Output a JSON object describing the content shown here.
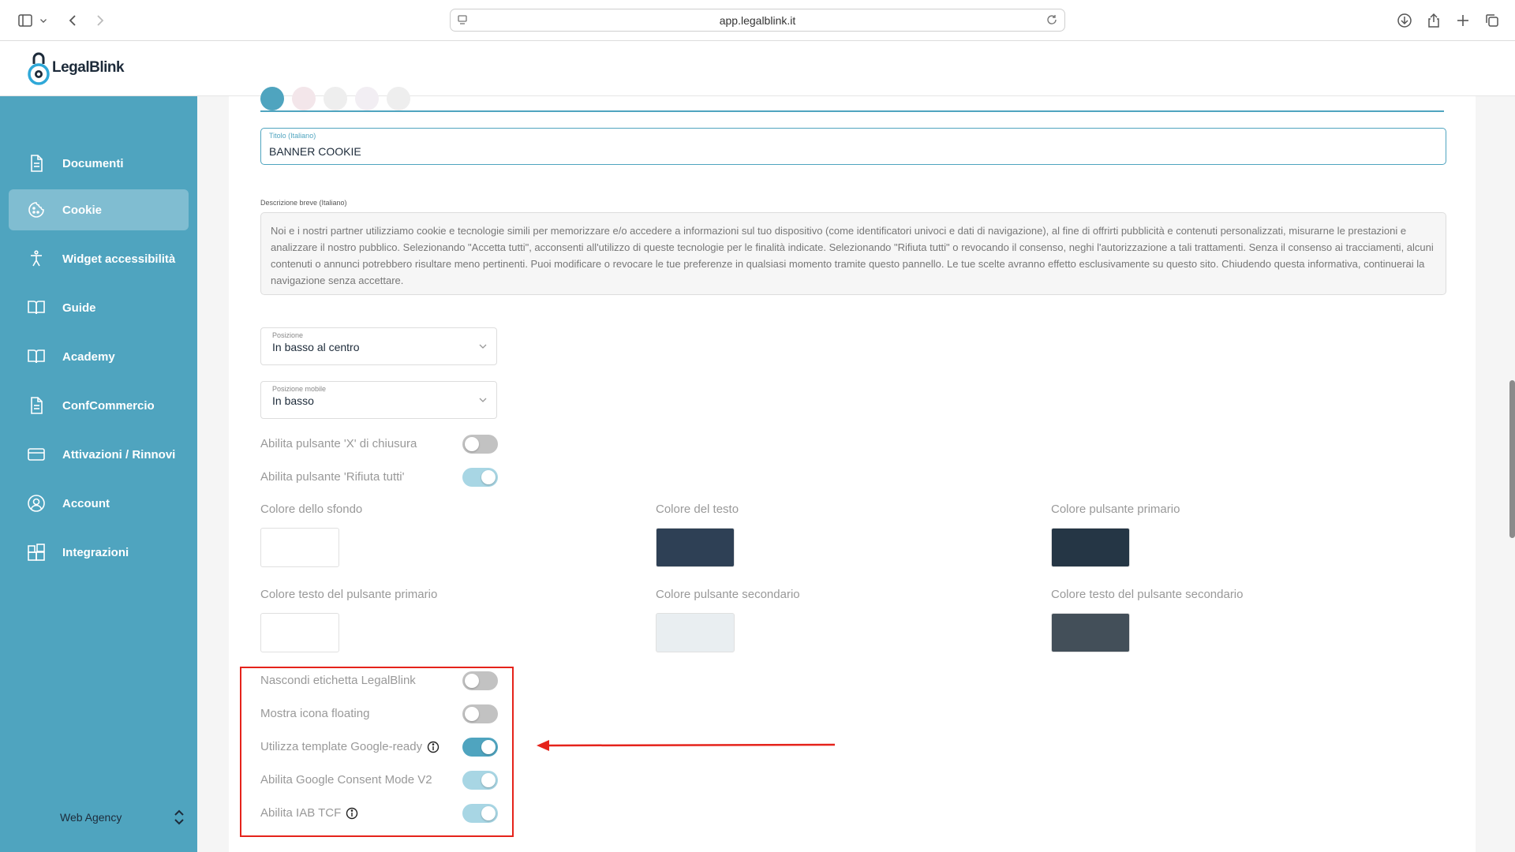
{
  "browser": {
    "url": "app.legalblink.it"
  },
  "app": {
    "logo_text": "LegalBlink"
  },
  "sidebar": {
    "items": [
      {
        "label": "Documenti",
        "icon": "document-icon"
      },
      {
        "label": "Cookie",
        "icon": "cookie-icon",
        "active": true
      },
      {
        "label": "Widget accessibilità",
        "icon": "accessibility-icon"
      },
      {
        "label": "Guide",
        "icon": "book-icon"
      },
      {
        "label": "Academy",
        "icon": "book-icon"
      },
      {
        "label": "ConfCommercio",
        "icon": "document-icon"
      },
      {
        "label": "Attivazioni / Rinnovi",
        "icon": "card-icon"
      },
      {
        "label": "Account",
        "icon": "user-icon"
      },
      {
        "label": "Integrazioni",
        "icon": "integrations-icon"
      }
    ],
    "agency_label": "Web Agency"
  },
  "form": {
    "title_label": "Titolo (Italiano)",
    "title_value": "BANNER COOKIE",
    "description_label": "Descrizione breve (Italiano)",
    "description_value": "Noi e i nostri partner utilizziamo cookie e tecnologie simili per memorizzare e/o accedere a informazioni sul tuo dispositivo (come identificatori univoci e dati di navigazione), al fine di offrirti pubblicità e contenuti personalizzati, misurarne le prestazioni e analizzare il nostro pubblico. Selezionando \"Accetta tutti\", acconsenti all'utilizzo di queste tecnologie per le finalità indicate. Selezionando \"Rifiuta tutti\" o revocando il consenso, neghi l'autorizzazione a tali trattamenti. Senza il consenso ai tracciamenti, alcuni contenuti o annunci potrebbero risultare meno pertinenti. Puoi modificare o revocare le tue preferenze in qualsiasi momento tramite questo pannello. Le tue scelte avranno effetto esclusivamente su questo sito. Chiudendo questa informativa, continuerai la navigazione senza accettare.",
    "position_label": "Posizione",
    "position_value": "In basso al centro",
    "mobile_position_label": "Posizione mobile",
    "mobile_position_value": "In basso",
    "toggles_top": [
      {
        "label": "Abilita pulsante 'X' di chiusura",
        "on": false
      },
      {
        "label": "Abilita pulsante 'Rifiuta tutti'",
        "on": true,
        "faded": true
      }
    ],
    "colors": [
      {
        "label": "Colore dello sfondo",
        "value": "#ffffff"
      },
      {
        "label": "Colore del testo",
        "value": "#2e4055"
      },
      {
        "label": "Colore pulsante primario",
        "value": "#253645"
      },
      {
        "label": "Colore testo del pulsante primario",
        "value": "#ffffff"
      },
      {
        "label": "Colore pulsante secondario",
        "value": "#e9eef1"
      },
      {
        "label": "Colore testo del pulsante secondario",
        "value": "#434f59"
      }
    ],
    "toggles_bottom": [
      {
        "label": "Nascondi etichetta LegalBlink",
        "on": false
      },
      {
        "label": "Mostra icona floating",
        "on": false
      },
      {
        "label": "Utilizza template Google-ready",
        "on": true,
        "info": true
      },
      {
        "label": "Abilita Google Consent Mode V2",
        "on": true,
        "faded": true
      },
      {
        "label": "Abilita IAB TCF",
        "on": true,
        "faded": true,
        "info": true
      }
    ]
  },
  "colors": {
    "accent": "#4fa4bf",
    "highlight": "#e5231b"
  }
}
